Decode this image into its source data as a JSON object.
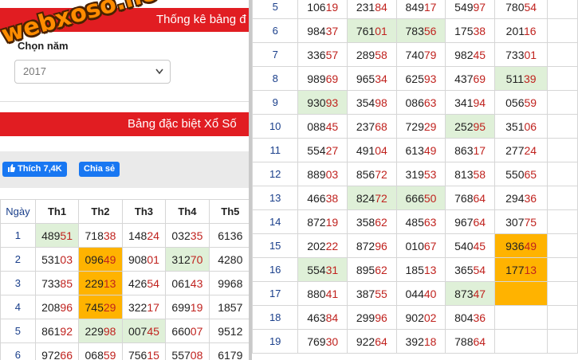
{
  "header": {
    "stats_title": "Thống kê bảng đ",
    "special_title": "Bảng đặc biệt Xổ Số"
  },
  "year_filter": {
    "label": "Chọn năm",
    "value": "2017"
  },
  "social": {
    "like_label": "Thích 7,4K",
    "share_label": "Chia sẻ"
  },
  "watermark": "webxoso.net",
  "left_table": {
    "headers": [
      "Ngày",
      "Th1",
      "Th2",
      "Th3",
      "Th4",
      "Th5"
    ],
    "rows": [
      {
        "day": "1",
        "cells": [
          {
            "v": "48951",
            "c": "hl"
          },
          {
            "v": "71838"
          },
          {
            "v": "14824"
          },
          {
            "v": "03235"
          },
          {
            "v": "6136"
          }
        ]
      },
      {
        "day": "2",
        "cells": [
          {
            "v": "53103"
          },
          {
            "v": "09649",
            "c": "gold"
          },
          {
            "v": "90801"
          },
          {
            "v": "31270",
            "c": "hl"
          },
          {
            "v": "4280"
          }
        ]
      },
      {
        "day": "3",
        "cells": [
          {
            "v": "73385"
          },
          {
            "v": "22913",
            "c": "gold"
          },
          {
            "v": "42654"
          },
          {
            "v": "06143"
          },
          {
            "v": "9968"
          }
        ]
      },
      {
        "day": "4",
        "cells": [
          {
            "v": "20896"
          },
          {
            "v": "74529",
            "c": "gold"
          },
          {
            "v": "32217"
          },
          {
            "v": "69919"
          },
          {
            "v": "1857"
          }
        ]
      },
      {
        "day": "5",
        "cells": [
          {
            "v": "86192"
          },
          {
            "v": "22998",
            "c": "hl"
          },
          {
            "v": "00745",
            "c": "hl"
          },
          {
            "v": "66007"
          },
          {
            "v": "9512"
          }
        ]
      },
      {
        "day": "6",
        "cells": [
          {
            "v": "97266"
          },
          {
            "v": "06859"
          },
          {
            "v": "75615"
          },
          {
            "v": "55708"
          },
          {
            "v": "6179"
          }
        ]
      }
    ]
  },
  "right_table": {
    "rows": [
      {
        "day": "5",
        "cells": [
          {
            "v": "10619"
          },
          {
            "v": "23184"
          },
          {
            "v": "84917"
          },
          {
            "v": "54997"
          },
          {
            "v": "78054"
          }
        ]
      },
      {
        "day": "6",
        "cells": [
          {
            "v": "98437"
          },
          {
            "v": "76101",
            "c": "hl"
          },
          {
            "v": "78356",
            "c": "hl"
          },
          {
            "v": "17538"
          },
          {
            "v": "20116"
          }
        ]
      },
      {
        "day": "7",
        "cells": [
          {
            "v": "33657"
          },
          {
            "v": "28958"
          },
          {
            "v": "74079"
          },
          {
            "v": "98245"
          },
          {
            "v": "73301"
          }
        ]
      },
      {
        "day": "8",
        "cells": [
          {
            "v": "98969"
          },
          {
            "v": "96534"
          },
          {
            "v": "62593"
          },
          {
            "v": "43769"
          },
          {
            "v": "51139",
            "c": "hl"
          }
        ]
      },
      {
        "day": "9",
        "cells": [
          {
            "v": "93093",
            "c": "hl"
          },
          {
            "v": "35498"
          },
          {
            "v": "08663"
          },
          {
            "v": "34194"
          },
          {
            "v": "05659"
          }
        ]
      },
      {
        "day": "10",
        "cells": [
          {
            "v": "08845"
          },
          {
            "v": "23768"
          },
          {
            "v": "72929"
          },
          {
            "v": "25295",
            "c": "hl"
          },
          {
            "v": "35106"
          }
        ]
      },
      {
        "day": "11",
        "cells": [
          {
            "v": "55427"
          },
          {
            "v": "49104"
          },
          {
            "v": "61349"
          },
          {
            "v": "86317"
          },
          {
            "v": "27724"
          }
        ]
      },
      {
        "day": "12",
        "cells": [
          {
            "v": "88903"
          },
          {
            "v": "85672"
          },
          {
            "v": "31953"
          },
          {
            "v": "81358"
          },
          {
            "v": "55065"
          }
        ]
      },
      {
        "day": "13",
        "cells": [
          {
            "v": "46638"
          },
          {
            "v": "82472",
            "c": "hl"
          },
          {
            "v": "66650",
            "c": "hl"
          },
          {
            "v": "76864"
          },
          {
            "v": "29436"
          }
        ]
      },
      {
        "day": "14",
        "cells": [
          {
            "v": "87219"
          },
          {
            "v": "35862"
          },
          {
            "v": "48563"
          },
          {
            "v": "96764"
          },
          {
            "v": "30775"
          }
        ]
      },
      {
        "day": "15",
        "cells": [
          {
            "v": "20222"
          },
          {
            "v": "87296"
          },
          {
            "v": "01067"
          },
          {
            "v": "54045"
          },
          {
            "v": "93649",
            "c": "gold"
          }
        ]
      },
      {
        "day": "16",
        "cells": [
          {
            "v": "55431",
            "c": "hl"
          },
          {
            "v": "89562"
          },
          {
            "v": "18513"
          },
          {
            "v": "36554"
          },
          {
            "v": "17713",
            "c": "gold"
          }
        ]
      },
      {
        "day": "17",
        "cells": [
          {
            "v": "88041"
          },
          {
            "v": "38755"
          },
          {
            "v": "04440"
          },
          {
            "v": "87347",
            "c": "hl"
          },
          {
            "v": "",
            "c": "gold"
          }
        ]
      },
      {
        "day": "18",
        "cells": [
          {
            "v": "46384"
          },
          {
            "v": "29996"
          },
          {
            "v": "90202"
          },
          {
            "v": "80436"
          },
          {
            "v": ""
          }
        ]
      },
      {
        "day": "19",
        "cells": [
          {
            "v": "76930"
          },
          {
            "v": "92264"
          },
          {
            "v": "39218"
          },
          {
            "v": "78864"
          },
          {
            "v": ""
          }
        ]
      }
    ]
  },
  "colors": {
    "header_red": "#e11d22",
    "highlight_green": "#dff0d8",
    "highlight_gold": "#ffb300",
    "digit_red": "#c0221e",
    "facebook_blue": "#1877f2"
  }
}
